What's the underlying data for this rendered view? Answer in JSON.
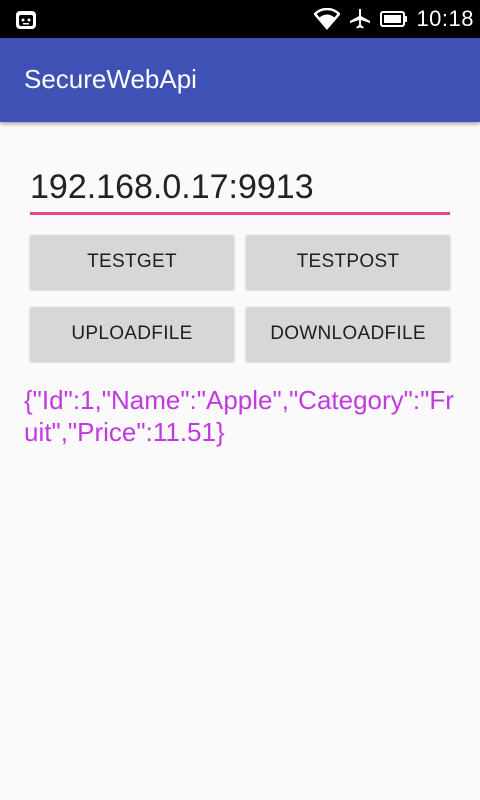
{
  "status_bar": {
    "time": "10:18",
    "icons": [
      "app-notification-icon",
      "wifi-icon",
      "airplane-mode-icon",
      "battery-icon"
    ]
  },
  "app_bar": {
    "title": "SecureWebApi",
    "color": "#3f51b5"
  },
  "main": {
    "host_input": {
      "value": "192.168.0.17:9913",
      "accent_color": "#e8478b"
    },
    "buttons": {
      "test_get": "TESTGET",
      "test_post": "TESTPOST",
      "upload_file": "UPLOADFILE",
      "download_file": "DOWNLOADFILE"
    },
    "response_text": "{\"Id\":1,\"Name\":\"Apple\",\"Category\":\"Fruit\",\"Price\":11.51}",
    "response_color": "#c13ae0"
  }
}
